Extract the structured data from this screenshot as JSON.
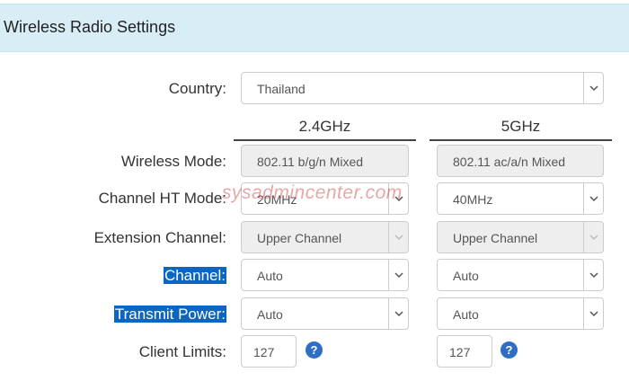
{
  "header": {
    "title": "Wireless Radio Settings"
  },
  "country": {
    "label": "Country:",
    "value": "Thailand"
  },
  "columns": {
    "band1": "2.4GHz",
    "band2": "5GHz"
  },
  "rows": {
    "wireless_mode": {
      "label": "Wireless Mode:",
      "band1": "802.11 b/g/n Mixed",
      "band2": "802.11 ac/a/n Mixed"
    },
    "channel_ht_mode": {
      "label": "Channel HT Mode:",
      "band1": "20MHz",
      "band2": "40MHz"
    },
    "extension_channel": {
      "label": "Extension Channel:",
      "band1": "Upper Channel",
      "band2": "Upper Channel"
    },
    "channel": {
      "label": "Channel:",
      "band1": "Auto",
      "band2": "Auto"
    },
    "transmit_power": {
      "label": "Transmit Power:",
      "band1": "Auto",
      "band2": "Auto"
    },
    "client_limits": {
      "label": "Client Limits:",
      "band1": "127",
      "band2": "127",
      "help": "?"
    }
  },
  "watermark": "sysadmincenter.com",
  "colors": {
    "header_bg": "#d9edf7",
    "highlight": "#0a66c2",
    "help_icon": "#2e6fc4"
  }
}
